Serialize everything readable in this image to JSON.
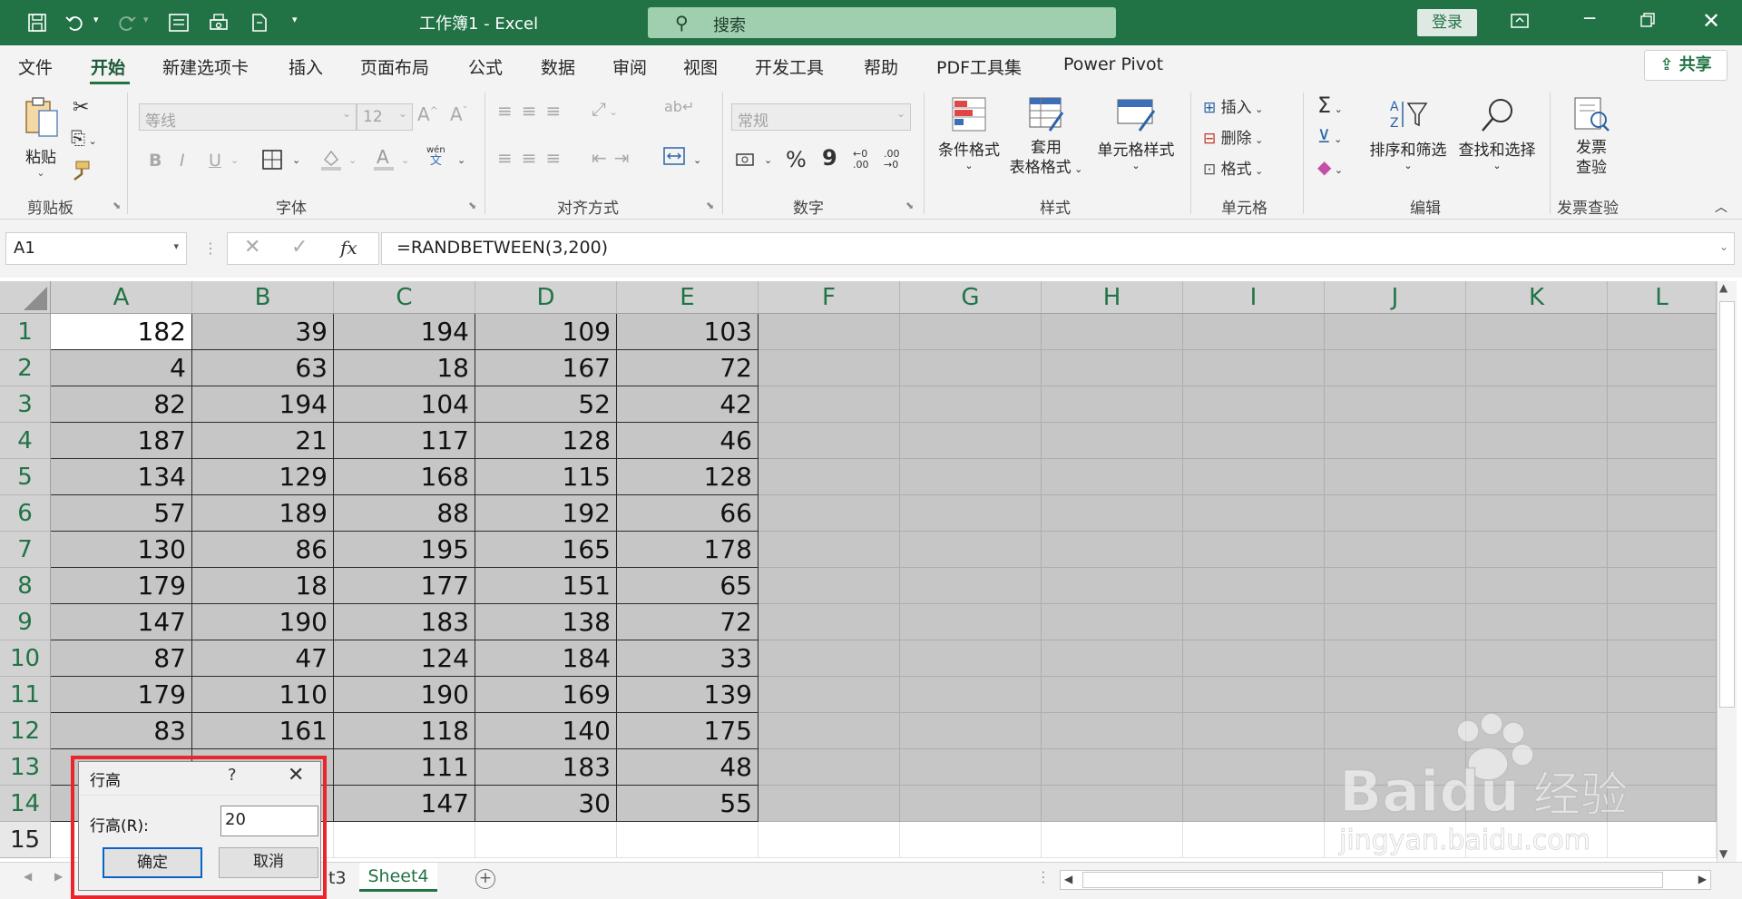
{
  "app": {
    "title": "工作簿1  -  Excel",
    "login": "登录"
  },
  "search": {
    "placeholder": "搜索"
  },
  "tabs": [
    "文件",
    "开始",
    "新建选项卡",
    "插入",
    "页面布局",
    "公式",
    "数据",
    "审阅",
    "视图",
    "开发工具",
    "帮助",
    "PDF工具集",
    "Power Pivot"
  ],
  "share": "共享",
  "ribbon": {
    "clipboard": {
      "paste": "粘贴",
      "label": "剪贴板"
    },
    "font": {
      "name": "等线",
      "size": "12",
      "label": "字体",
      "bold": "B",
      "italic": "I",
      "underline": "U",
      "phonetic_top": "wén",
      "phonetic_bottom": "文"
    },
    "align": {
      "label": "对齐方式"
    },
    "number": {
      "format": "常规",
      "percent": "%",
      "comma": "9",
      "label": "数字",
      "inc": "←0 .00",
      "dec": ".00 →0"
    },
    "styles": {
      "cond": "条件格式",
      "table_1": "套用",
      "table_2": "表格格式",
      "cell": "单元格样式",
      "label": "样式"
    },
    "cells": {
      "insert": "插入",
      "delete": "删除",
      "format": "格式",
      "label": "单元格"
    },
    "editing": {
      "sort": "排序和筛选",
      "find": "查找和选择",
      "label": "编辑"
    },
    "invoice": {
      "line1": "发票",
      "line2": "查验",
      "label": "发票查验"
    }
  },
  "formula_bar": {
    "name_box": "A1",
    "fx": "fx",
    "formula": "=RANDBETWEEN(3,200)"
  },
  "columns": [
    "A",
    "B",
    "C",
    "D",
    "E",
    "F",
    "G",
    "H",
    "I",
    "J",
    "K",
    "L"
  ],
  "rows": [
    [
      182,
      39,
      194,
      109,
      103
    ],
    [
      4,
      63,
      18,
      167,
      72
    ],
    [
      82,
      194,
      104,
      52,
      42
    ],
    [
      187,
      21,
      117,
      128,
      46
    ],
    [
      134,
      129,
      168,
      115,
      128
    ],
    [
      57,
      189,
      88,
      192,
      66
    ],
    [
      130,
      86,
      195,
      165,
      178
    ],
    [
      179,
      18,
      177,
      151,
      65
    ],
    [
      147,
      190,
      183,
      138,
      72
    ],
    [
      87,
      47,
      124,
      184,
      33
    ],
    [
      179,
      110,
      190,
      169,
      139
    ],
    [
      83,
      161,
      118,
      140,
      175
    ],
    [
      null,
      null,
      111,
      183,
      48
    ],
    [
      null,
      null,
      147,
      30,
      55
    ]
  ],
  "row_numbers": [
    "1",
    "2",
    "3",
    "4",
    "5",
    "6",
    "7",
    "8",
    "9",
    "10",
    "11",
    "12",
    "13",
    "14",
    "15"
  ],
  "sheets": {
    "partial": "t3",
    "active": "Sheet4",
    "add": "+"
  },
  "dialog": {
    "title": "行高",
    "help": "?",
    "label": "行高(R):",
    "value": "20",
    "ok": "确定",
    "cancel": "取消"
  },
  "watermark": {
    "brand": "Baidu",
    "cn": "经验",
    "url": "jingyan.baidu.com"
  },
  "colors": {
    "excel_green": "#217346",
    "selection_gray": "#c6c6c6",
    "highlight_red": "#e8262b"
  }
}
